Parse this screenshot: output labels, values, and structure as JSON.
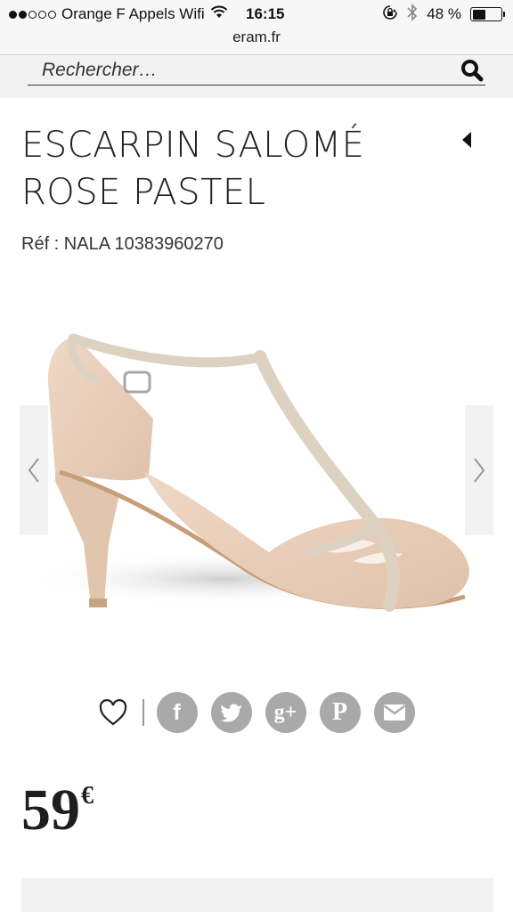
{
  "status_bar": {
    "signal_dots_filled": 2,
    "signal_dots_total": 5,
    "carrier": "Orange F Appels Wifi",
    "time": "16:15",
    "battery_text": "48 %",
    "battery_level": 0.48,
    "icons": [
      "wifi-icon",
      "orientation-lock-icon",
      "bluetooth-icon",
      "battery-icon"
    ]
  },
  "browser": {
    "url": "eram.fr"
  },
  "search": {
    "placeholder": "Rechercher…",
    "button_icon": "search-icon"
  },
  "product": {
    "title": "ESCARPIN SALOMÉ ROSE PASTEL",
    "ref": "Réf : NALA 10383960270",
    "price_amount": "59",
    "price_currency": "€",
    "image_subject": "shoe"
  },
  "carousel": {
    "prev_icon": "chevron-left-icon",
    "next_icon": "chevron-right-icon"
  },
  "share": {
    "wishlist_icon": "heart-icon",
    "buttons": [
      {
        "name": "facebook",
        "glyph": "f"
      },
      {
        "name": "twitter",
        "glyph": ""
      },
      {
        "name": "google-plus",
        "glyph": "g+"
      },
      {
        "name": "pinterest",
        "glyph": "P"
      },
      {
        "name": "email",
        "glyph": ""
      }
    ]
  },
  "colors": {
    "share_button": "#a9a9a9",
    "text": "#222222",
    "panel": "#f2f2f2",
    "shoe": "#e8cdb6"
  }
}
